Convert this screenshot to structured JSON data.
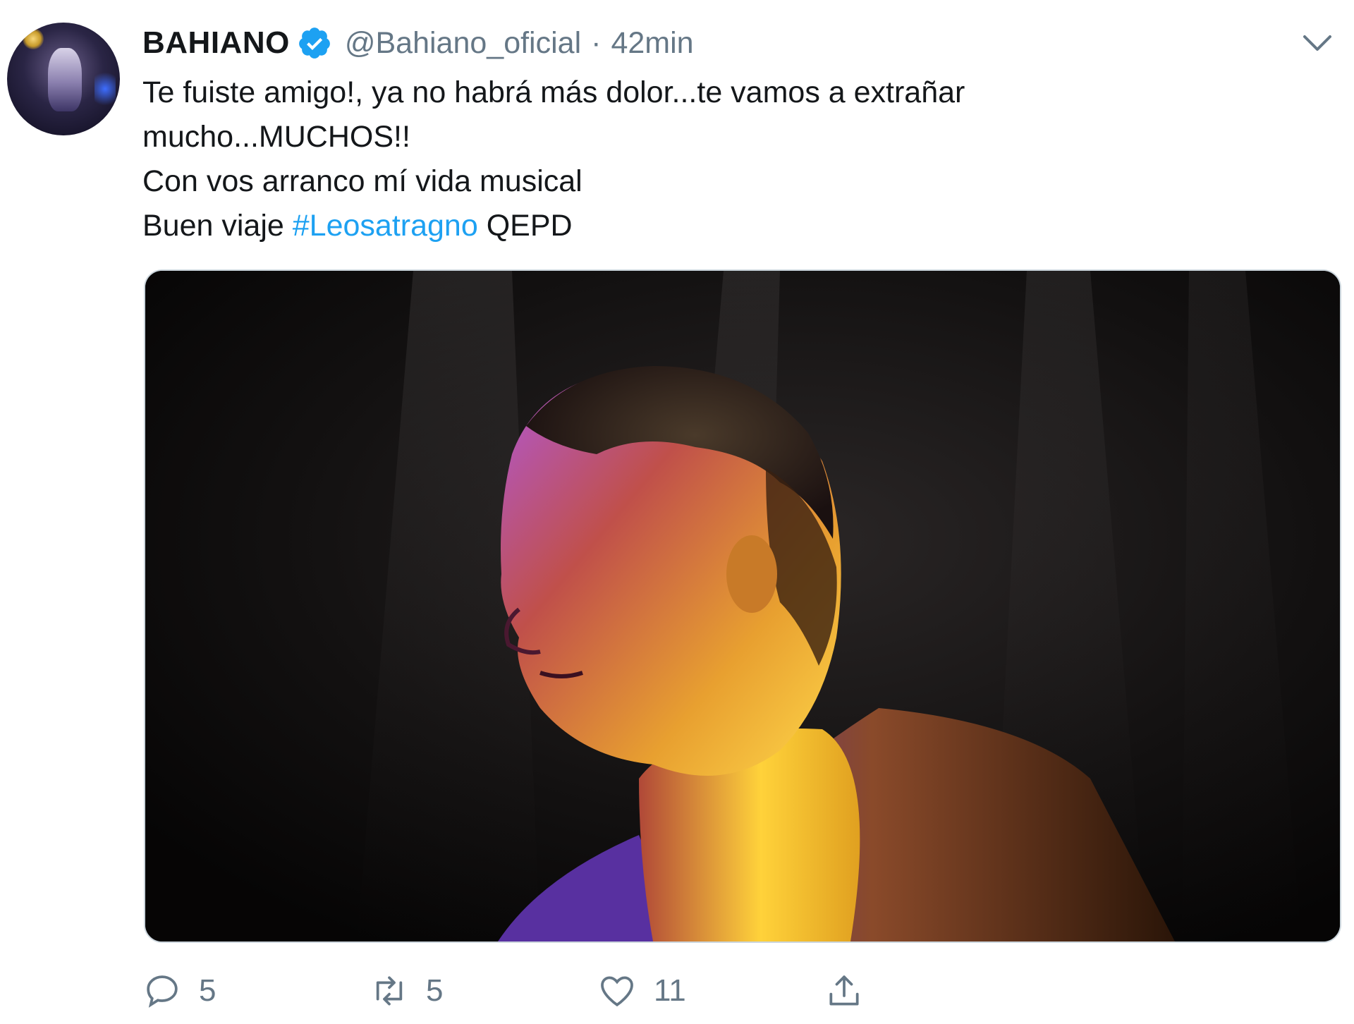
{
  "author": {
    "name": "BAHIANO",
    "handle": "@Bahiano_oficial",
    "separator": "·",
    "time": "42min",
    "verified": true
  },
  "tweet": {
    "line1": "Te fuiste amigo!, ya no habrá más dolor...te vamos a extrañar",
    "line2": "mucho...MUCHOS!!",
    "line3": "Con vos arranco mí vida musical",
    "line4_prefix": "Buen viaje ",
    "hashtag": "#Leosatragno",
    "line4_suffix": " QEPD"
  },
  "actions": {
    "reply_count": "5",
    "retweet_count": "5",
    "like_count": "11"
  },
  "icons": {
    "reply": "reply-icon",
    "retweet": "retweet-icon",
    "like": "heart-icon",
    "share": "share-icon",
    "menu": "chevron-down-icon",
    "verified": "verified-badge-icon"
  },
  "colors": {
    "link": "#1da1f2",
    "muted": "#657786",
    "text": "#14171a",
    "verified": "#1da1f2"
  }
}
